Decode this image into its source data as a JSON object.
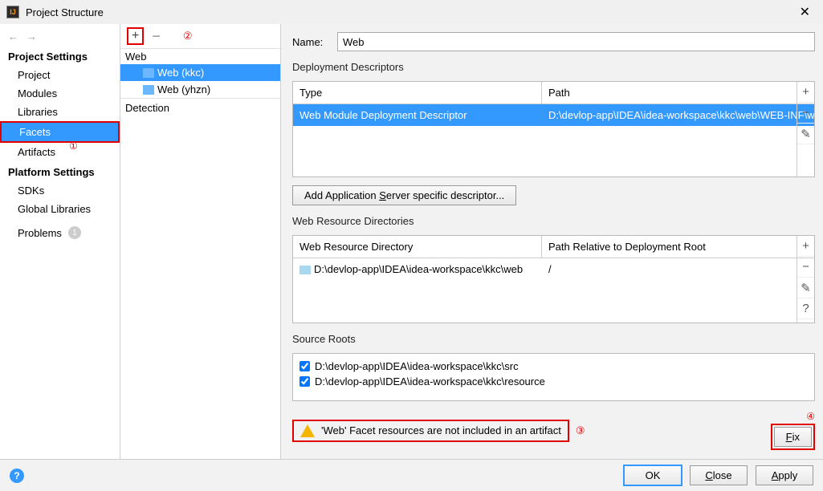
{
  "title": "Project Structure",
  "annotations": {
    "a1": "①",
    "a2": "②",
    "a3": "③",
    "a4": "④"
  },
  "nav": {
    "back_icon": "←",
    "forward_icon": "→",
    "project_settings_header": "Project Settings",
    "items_project": "Project",
    "items_modules": "Modules",
    "items_libraries": "Libraries",
    "items_facets": "Facets",
    "items_artifacts": "Artifacts",
    "platform_settings_header": "Platform Settings",
    "items_sdks": "SDKs",
    "items_global_libraries": "Global Libraries",
    "problems_label": "Problems",
    "problems_count": "1"
  },
  "tree": {
    "plus": "+",
    "minus": "−",
    "root": "Web",
    "child1": "Web (kkc)",
    "child2": "Web (yhzn)",
    "detection": "Detection"
  },
  "form": {
    "name_label": "Name:",
    "name_value": "Web",
    "deployment_descriptors_title": "Deployment Descriptors",
    "dd_col_type": "Type",
    "dd_col_path": "Path",
    "dd_row_type": "Web Module Deployment Descriptor",
    "dd_row_path": "D:\\devlop-app\\IDEA\\idea-workspace\\kkc\\web\\WEB-INF\\web.xml",
    "add_server_descriptor_btn": "Add Application Server specific descriptor...",
    "web_resource_title": "Web Resource Directories",
    "wr_col_dir": "Web Resource Directory",
    "wr_col_rel": "Path Relative to Deployment Root",
    "wr_row_dir": "D:\\devlop-app\\IDEA\\idea-workspace\\kkc\\web",
    "wr_row_rel": "/",
    "source_roots_title": "Source Roots",
    "src_root_1": "D:\\devlop-app\\IDEA\\idea-workspace\\kkc\\src",
    "src_root_2": "D:\\devlop-app\\IDEA\\idea-workspace\\kkc\\resource",
    "warning_text": "'Web' Facet resources are not included in an artifact",
    "fix_btn": "Fix"
  },
  "side_actions": {
    "add": "+",
    "remove": "−",
    "edit": "✎",
    "help": "?"
  },
  "footer": {
    "ok": "OK",
    "cancel": "Close",
    "apply": "Apply"
  }
}
